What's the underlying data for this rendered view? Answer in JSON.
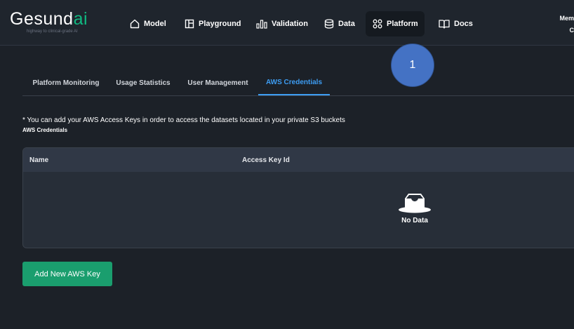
{
  "brand": {
    "name_prefix": "Gesund",
    "name_suffix": "ai",
    "tagline": "highway to clinical-grade AI"
  },
  "nav": {
    "items": [
      {
        "label": "Model",
        "icon": "home-icon"
      },
      {
        "label": "Playground",
        "icon": "layout-icon"
      },
      {
        "label": "Validation",
        "icon": "bar-chart-icon"
      },
      {
        "label": "Data",
        "icon": "database-icon"
      },
      {
        "label": "Platform",
        "icon": "apps-icon",
        "active": true
      },
      {
        "label": "Docs",
        "icon": "book-icon"
      }
    ],
    "member_line1": "Mem",
    "member_line2": "C"
  },
  "annotation": {
    "number": "1"
  },
  "tabs": [
    {
      "label": "Platform Monitoring"
    },
    {
      "label": "Usage Statistics"
    },
    {
      "label": "User Management"
    },
    {
      "label": "AWS Credentials",
      "active": true
    }
  ],
  "content": {
    "note": "* You can add your AWS Access Keys in order to access the datasets located in your private S3 buckets",
    "section_title": "AWS Credentials",
    "table": {
      "columns": [
        "Name",
        "Access Key Id"
      ],
      "rows": [],
      "empty_text": "No Data"
    },
    "add_button_label": "Add New AWS Key"
  },
  "colors": {
    "accent_tab": "#3d9df3",
    "primary_button": "#1a9e6e",
    "brand_ai": "#10b981",
    "annotation": "#4472c4"
  }
}
